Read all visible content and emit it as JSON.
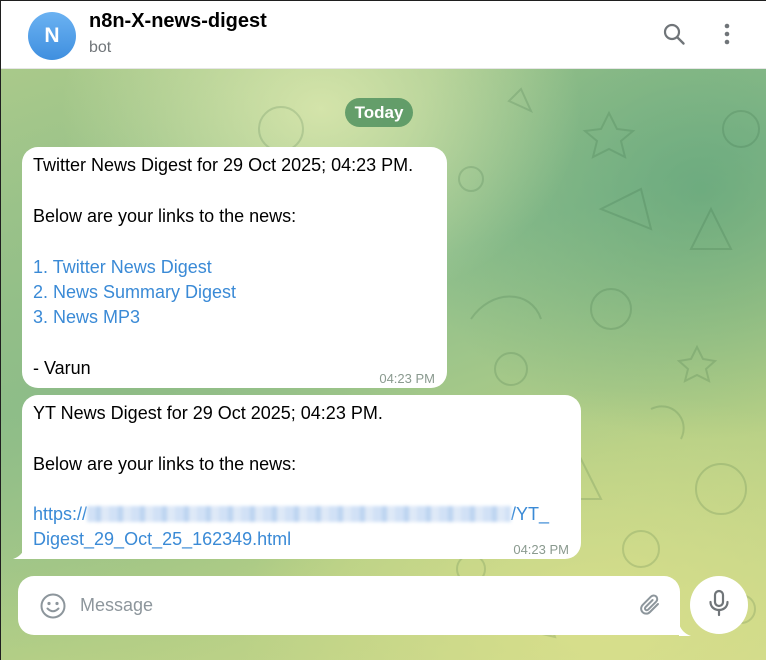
{
  "header": {
    "avatar_letter": "N",
    "title": "n8n-X-news-digest",
    "subtitle": "bot",
    "icons": [
      "search-icon",
      "more-vertical-icon"
    ]
  },
  "chat": {
    "date_label": "Today",
    "messages": [
      {
        "lines": [
          "Twitter News Digest for 29 Oct 2025; 04:23 PM.",
          "Below are your links to the news:",
          "- Varun"
        ],
        "links": [
          "1. Twitter News Digest",
          "2. News Summary Digest",
          "3. News MP3"
        ],
        "time": "04:23 PM"
      },
      {
        "lines": [
          "YT News Digest for 29 Oct 2025; 04:23 PM.",
          "Below are your links to the news:"
        ],
        "url_prefix": "https://",
        "url_suffix": "/YT_",
        "url_line2": "Digest_29_Oct_25_162349.html",
        "time": "04:23 PM"
      }
    ]
  },
  "composer": {
    "placeholder": "Message",
    "icons": [
      "emoji-icon",
      "attach-icon",
      "microphone-icon"
    ]
  },
  "colors": {
    "accent": "#3a8ad6",
    "avatar": "#4a96e3",
    "date_pill": "#4f9a62"
  }
}
